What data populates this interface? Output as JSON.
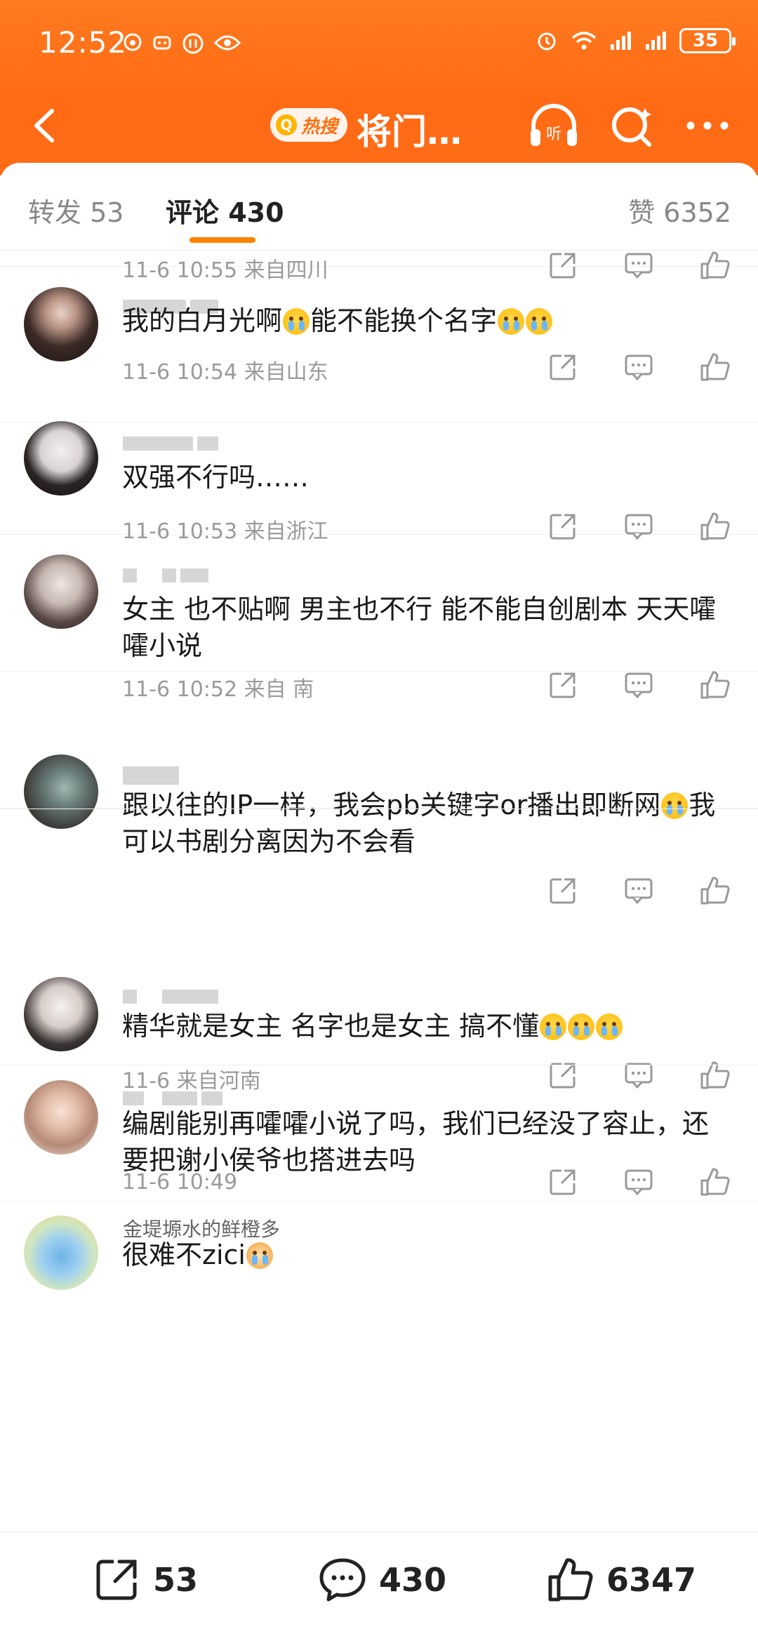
{
  "status_bar": {
    "time": "12:52",
    "battery": "35",
    "left_icons": [
      "weibo-icon",
      "bilibili-icon",
      "video-icon",
      "eye-icon"
    ],
    "right_icons": [
      "alarm-icon",
      "wifi-icon",
      "signal-icon",
      "signal-icon"
    ]
  },
  "nav": {
    "hot_label": "热搜",
    "title": "将门…"
  },
  "tabs": {
    "repost": "转发 53",
    "comment": "评论 430",
    "like": "赞 6352"
  },
  "comments": [
    {
      "username": "",
      "text": "",
      "meta": "11-6 10:55  来自四川"
    },
    {
      "username": "",
      "text": "我的白月光啊",
      "text_end": "能不能换个名字",
      "meta": "11-6 10:54  来自山东"
    },
    {
      "username": "",
      "text": "双强不行吗……",
      "meta": "11-6 10:53  来自浙江"
    },
    {
      "username": "",
      "text": "女主 也不贴啊 男主也不行 能不能自创剧本 天天嚯嚯小说",
      "meta": "11-6 10:52  来自 南"
    },
    {
      "username": "",
      "text": "跟以往的IP一样，我会pb关键字or播出即断网",
      "text_end": "我可以书剧分离因为不会看",
      "meta": ""
    },
    {
      "username": "",
      "text": "精华就是女主 名字也是女主 搞不懂",
      "meta": "11-6 来自河南"
    },
    {
      "username": "",
      "text": "编剧能别再嚯嚯小说了吗，我们已经没了容止，还要把谢小侯爷也搭进去吗",
      "meta": "11-6 10:49"
    },
    {
      "username": "金堤塬水的鲜橙多",
      "text": "很难不zici",
      "meta": ""
    }
  ],
  "bottom_bar": {
    "repost_count": "53",
    "comment_count": "430",
    "like_count": "6347"
  },
  "colors": {
    "header": "#ff6d18",
    "accent": "#ff8200"
  }
}
